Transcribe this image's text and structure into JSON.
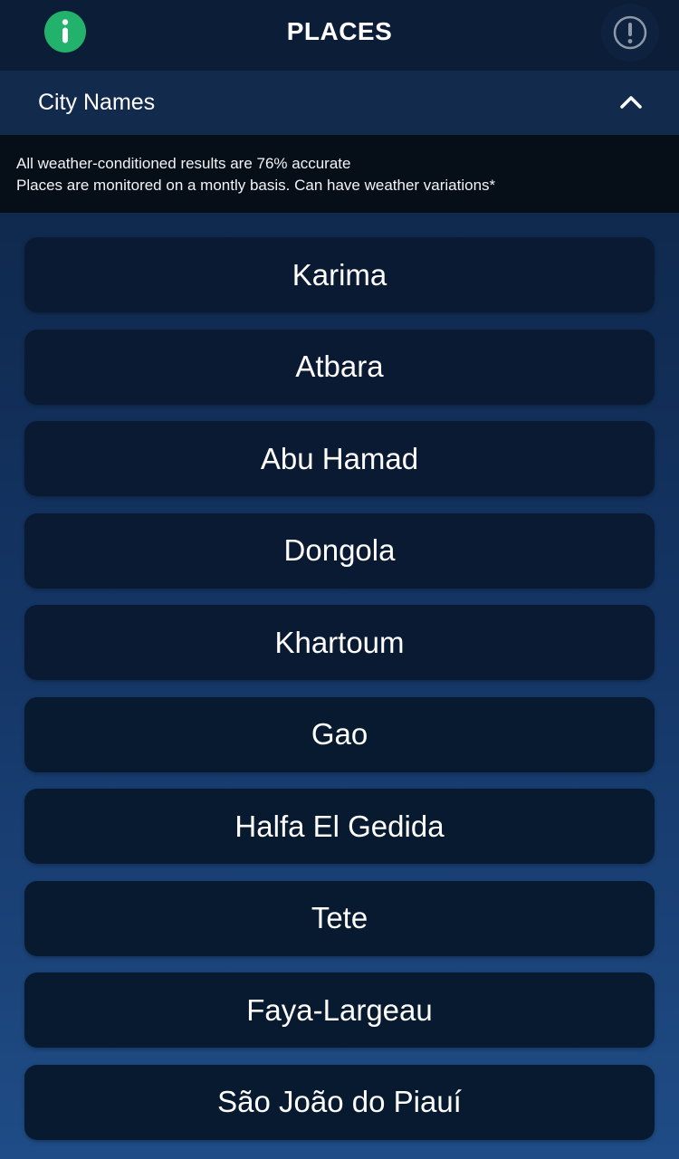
{
  "header": {
    "title": "PLACES",
    "info_icon": "info-icon",
    "alert_icon": "exclamation-icon"
  },
  "accordion": {
    "label": "City Names",
    "chevron_icon": "chevron-up-icon",
    "expanded": true
  },
  "notice": {
    "line1": "All weather-conditioned results are 76% accurate",
    "line2": "Places are monitored on a montly basis. Can have weather variations*"
  },
  "cities": [
    {
      "name": "Karima"
    },
    {
      "name": "Atbara"
    },
    {
      "name": "Abu Hamad"
    },
    {
      "name": "Dongola"
    },
    {
      "name": "Khartoum"
    },
    {
      "name": "Gao"
    },
    {
      "name": "Halfa El Gedida"
    },
    {
      "name": "Tete"
    },
    {
      "name": "Faya-Largeau"
    },
    {
      "name": "São João do Piauí"
    }
  ],
  "colors": {
    "background_top": "#0d2342",
    "background_bottom": "#1f4c86",
    "topbar": "#0b1d37",
    "info_accent": "#23b26b",
    "card": "#0a1a33"
  }
}
